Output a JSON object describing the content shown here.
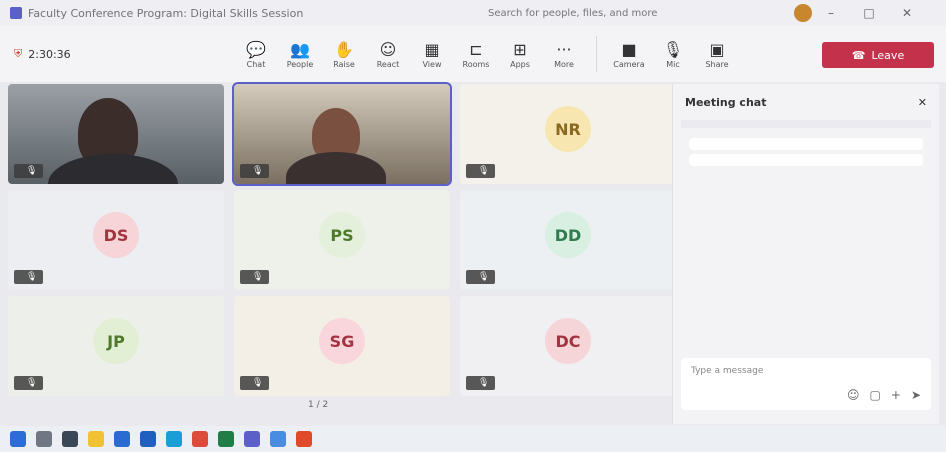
{
  "window": {
    "title": "Faculty Conference Program: Digital Skills Session",
    "search_placeholder": "Search for people, files, and more"
  },
  "toolbar": {
    "timer": "2:30:36",
    "items": [
      {
        "label": "Chat",
        "icon": "chat"
      },
      {
        "label": "People",
        "icon": "people"
      },
      {
        "label": "Raise",
        "icon": "raise-hand"
      },
      {
        "label": "React",
        "icon": "react"
      },
      {
        "label": "View",
        "icon": "view"
      },
      {
        "label": "Rooms",
        "icon": "rooms"
      },
      {
        "label": "Apps",
        "icon": "apps"
      },
      {
        "label": "More",
        "icon": "more"
      }
    ],
    "devices": [
      {
        "label": "Camera",
        "icon": "camera"
      },
      {
        "label": "Mic",
        "icon": "mic"
      },
      {
        "label": "Share",
        "icon": "share"
      }
    ],
    "leave_label": "Leave"
  },
  "tiles": [
    {
      "initials": "",
      "name": "",
      "video": true
    },
    {
      "initials": "",
      "name": "",
      "video": true
    },
    {
      "initials": "NR",
      "name": ""
    },
    {
      "initials": "DS",
      "name": ""
    },
    {
      "initials": "PS",
      "name": ""
    },
    {
      "initials": "DD",
      "name": ""
    },
    {
      "initials": "JP",
      "name": ""
    },
    {
      "initials": "SG",
      "name": ""
    },
    {
      "initials": "DC",
      "name": ""
    }
  ],
  "pagination": "1 / 2",
  "chat": {
    "title": "Meeting chat",
    "banner": "",
    "messages": [
      {
        "meta": "",
        "text": ""
      },
      {
        "meta": "",
        "text": ""
      }
    ],
    "composer_placeholder": "Type a message"
  },
  "taskbar": {
    "weather": "",
    "clock": ""
  },
  "colors": {
    "accent": "#5b5fc7",
    "leave": "#c4314b"
  }
}
